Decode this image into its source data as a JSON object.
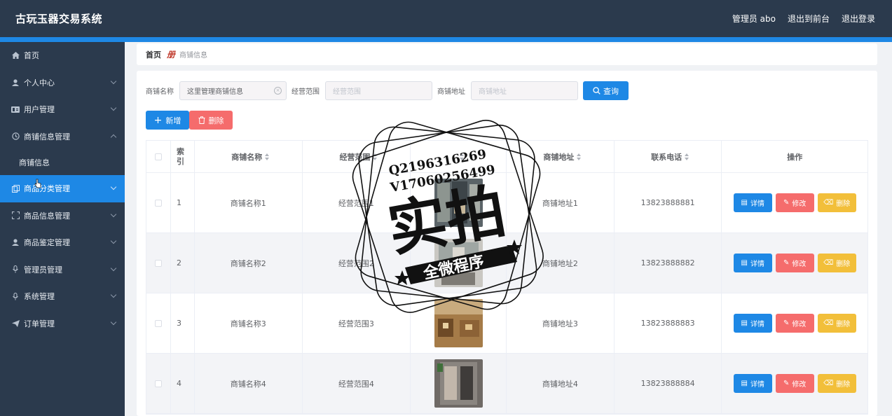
{
  "app": {
    "title": "古玩玉器交易系统"
  },
  "topbar": {
    "user": "管理员 abo",
    "to_front": "退出到前台",
    "logout": "退出登录"
  },
  "sidebar": {
    "items": [
      {
        "label": "首页",
        "icon": "home-icon"
      },
      {
        "label": "个人中心",
        "icon": "user-icon"
      },
      {
        "label": "用户管理",
        "icon": "users-icon"
      },
      {
        "label": "商铺信息管理",
        "icon": "clock-icon"
      },
      {
        "label": "商铺信息",
        "icon": ""
      },
      {
        "label": "商品分类管理",
        "icon": "copy-icon"
      },
      {
        "label": "商品信息管理",
        "icon": "fullscreen-icon"
      },
      {
        "label": "商品鉴定管理",
        "icon": "user-icon"
      },
      {
        "label": "管理员管理",
        "icon": "microphone-icon"
      },
      {
        "label": "系统管理",
        "icon": "microphone-icon"
      },
      {
        "label": "订单管理",
        "icon": "send-icon"
      }
    ]
  },
  "breadcrumb": {
    "home": "首页",
    "sep": "册",
    "current": "商铺信息"
  },
  "search": {
    "name_label": "商铺名称",
    "name_value": "这里管理商铺信息",
    "scope_label": "经营范围",
    "scope_placeholder": "经营范围",
    "addr_label": "商铺地址",
    "addr_placeholder": "商铺地址",
    "query_label": "查询"
  },
  "actions": {
    "add_label": "新增",
    "delete_label": "删除"
  },
  "table": {
    "headers": {
      "index": "索引",
      "name": "商铺名称",
      "scope": "经营范围",
      "image": "",
      "addr": "商铺地址",
      "tel": "联系电话",
      "op": "操作"
    },
    "rows": [
      {
        "idx": "1",
        "name": "商铺名称1",
        "scope": "经营范围1",
        "addr": "商铺地址1",
        "tel": "13823888881"
      },
      {
        "idx": "2",
        "name": "商铺名称2",
        "scope": "经营范围2",
        "addr": "商铺地址2",
        "tel": "13823888882"
      },
      {
        "idx": "3",
        "name": "商铺名称3",
        "scope": "经营范围3",
        "addr": "商铺地址3",
        "tel": "13823888883"
      },
      {
        "idx": "4",
        "name": "商铺名称4",
        "scope": "经营范围4",
        "addr": "商铺地址4",
        "tel": "13823888884"
      }
    ],
    "row_actions": {
      "detail": "详情",
      "edit": "修改",
      "delete": "删除"
    }
  },
  "watermark": {
    "line1": "Q2196316269",
    "line2": "V17060256499",
    "main": "实拍",
    "ribbon": "全微程序"
  },
  "colors": {
    "topbar": "#2b3a4d",
    "accent": "#1e88e5",
    "danger": "#f56c6c",
    "warning": "#f2bf3a"
  }
}
